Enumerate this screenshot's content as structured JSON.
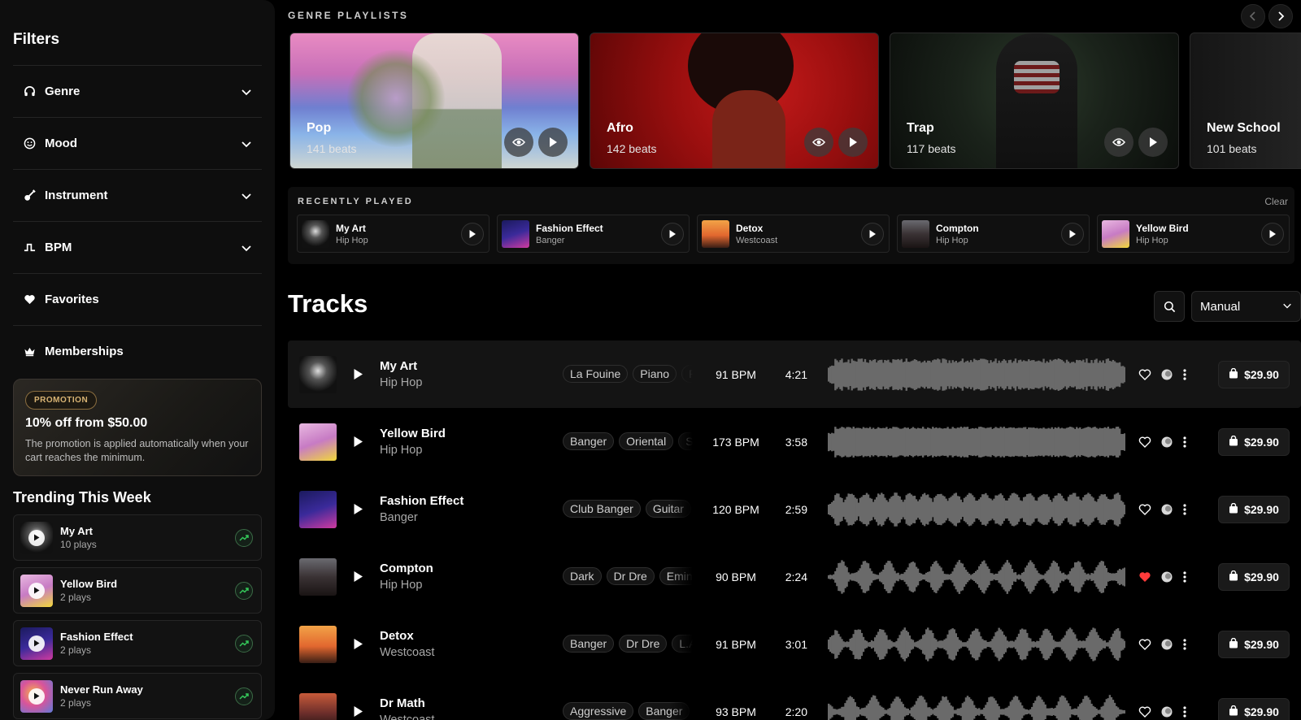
{
  "sidebar": {
    "title": "Filters",
    "filters": [
      {
        "label": "Genre",
        "icon": "headphones-icon"
      },
      {
        "label": "Mood",
        "icon": "smile-icon"
      },
      {
        "label": "Instrument",
        "icon": "guitar-icon"
      },
      {
        "label": "BPM",
        "icon": "bpm-icon"
      }
    ],
    "links": [
      {
        "label": "Favorites",
        "icon": "heart-icon"
      },
      {
        "label": "Memberships",
        "icon": "crown-icon"
      }
    ],
    "promo": {
      "badge": "PROMOTION",
      "title": "10% off from $50.00",
      "text": "The promotion is applied automatically when your cart reaches the minimum."
    },
    "trending": {
      "title": "Trending This Week",
      "items": [
        {
          "name": "My Art",
          "plays": "10 plays"
        },
        {
          "name": "Yellow Bird",
          "plays": "2 plays"
        },
        {
          "name": "Fashion Effect",
          "plays": "2 plays"
        },
        {
          "name": "Never Run Away",
          "plays": "2 plays"
        }
      ]
    }
  },
  "genres": {
    "label": "GENRE PLAYLISTS",
    "cards": [
      {
        "name": "Pop",
        "beats": "141 beats"
      },
      {
        "name": "Afro",
        "beats": "142 beats"
      },
      {
        "name": "Trap",
        "beats": "117 beats"
      },
      {
        "name": "New School",
        "beats": "101 beats"
      }
    ]
  },
  "recent": {
    "label": "RECENTLY PLAYED",
    "clear": "Clear",
    "items": [
      {
        "name": "My Art",
        "genre": "Hip Hop"
      },
      {
        "name": "Fashion Effect",
        "genre": "Banger"
      },
      {
        "name": "Detox",
        "genre": "Westcoast"
      },
      {
        "name": "Compton",
        "genre": "Hip Hop"
      },
      {
        "name": "Yellow Bird",
        "genre": "Hip Hop"
      }
    ]
  },
  "tracks": {
    "title": "Tracks",
    "sort": "Manual",
    "rows": [
      {
        "name": "My Art",
        "genre": "Hip Hop",
        "tags": [
          "La Fouine",
          "Piano",
          "Ry"
        ],
        "bpm": "91 BPM",
        "duration": "4:21",
        "price": "$29.90",
        "liked": false
      },
      {
        "name": "Yellow Bird",
        "genre": "Hip Hop",
        "tags": [
          "Banger",
          "Oriental",
          "Sa"
        ],
        "bpm": "173 BPM",
        "duration": "3:58",
        "price": "$29.90",
        "liked": false
      },
      {
        "name": "Fashion Effect",
        "genre": "Banger",
        "tags": [
          "Club Banger",
          "Guitar"
        ],
        "bpm": "120 BPM",
        "duration": "2:59",
        "price": "$29.90",
        "liked": false
      },
      {
        "name": "Compton",
        "genre": "Hip Hop",
        "tags": [
          "Dark",
          "Dr Dre",
          "Emine"
        ],
        "bpm": "90 BPM",
        "duration": "2:24",
        "price": "$29.90",
        "liked": true
      },
      {
        "name": "Detox",
        "genre": "Westcoast",
        "tags": [
          "Banger",
          "Dr Dre",
          "L.A."
        ],
        "bpm": "91 BPM",
        "duration": "3:01",
        "price": "$29.90",
        "liked": false
      },
      {
        "name": "Dr Math",
        "genre": "Westcoast",
        "tags": [
          "Aggressive",
          "Banger"
        ],
        "bpm": "93 BPM",
        "duration": "2:20",
        "price": "$29.90",
        "liked": false
      }
    ]
  },
  "colors": {
    "accent_red": "#ff3b3b",
    "trend_green": "#34c759"
  }
}
